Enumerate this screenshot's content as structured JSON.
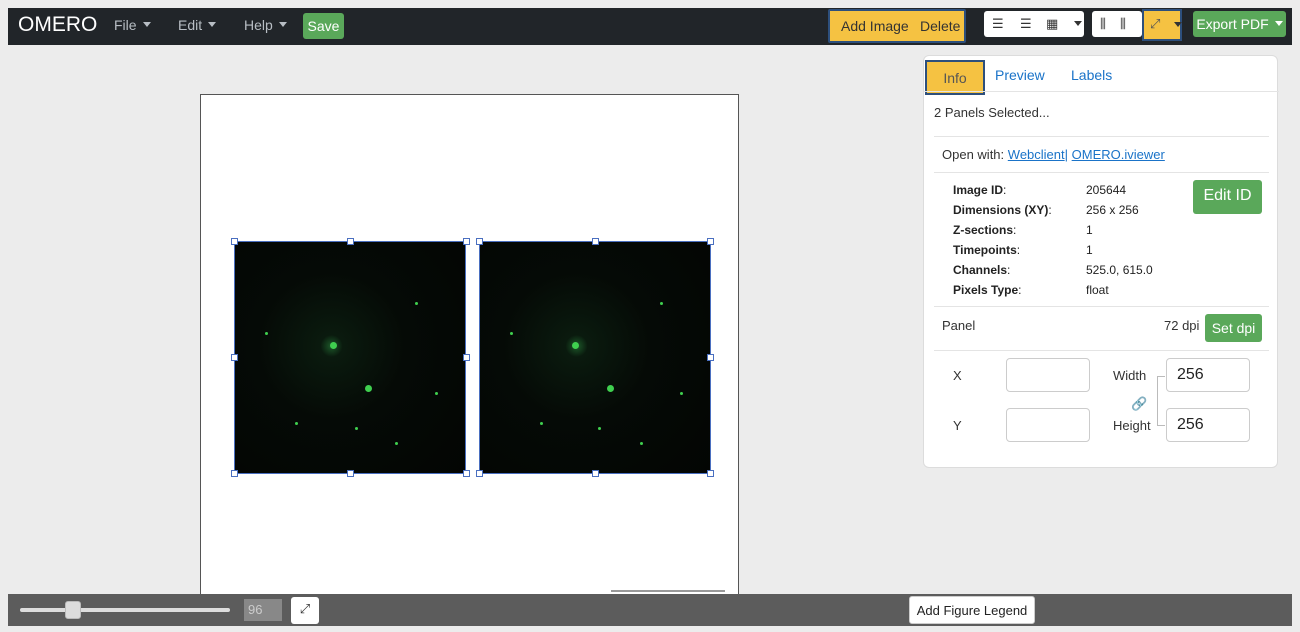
{
  "app": {
    "brand": "OMERO"
  },
  "menu": {
    "file": "File",
    "edit": "Edit",
    "help": "Help",
    "save": "Save"
  },
  "toolbar": {
    "add_image": "Add Image",
    "delete": "Delete",
    "export": "Export PDF"
  },
  "tabs": {
    "info": "Info",
    "preview": "Preview",
    "labels": "Labels"
  },
  "info": {
    "selected": "2 Panels Selected...",
    "open_with_label": "Open with:",
    "webclient": "Webclient",
    "separator": "|",
    "iviewer": "OMERO.iviewer",
    "edit_id": "Edit ID",
    "fields": [
      {
        "key": "Image ID",
        "value": "205644"
      },
      {
        "key": "Dimensions (XY)",
        "value": "256 x 256"
      },
      {
        "key": "Z-sections",
        "value": "1"
      },
      {
        "key": "Timepoints",
        "value": "1"
      },
      {
        "key": "Channels",
        "value": "525.0, 615.0"
      },
      {
        "key": "Pixels Type",
        "value": "float"
      }
    ],
    "panel_label": "Panel",
    "dpi": "72 dpi",
    "set_dpi": "Set dpi",
    "x_label": "X",
    "y_label": "Y",
    "x_value": "",
    "y_value": "",
    "width_label": "Width",
    "height_label": "Height",
    "width_value": "256",
    "height_value": "256"
  },
  "footer": {
    "zoom": "96",
    "zoom_fraction": 0.25,
    "legend": "Add Figure Legend"
  },
  "colors": {
    "accent": "#f5c242",
    "green": "#5aa85a",
    "dark": "#212529"
  }
}
